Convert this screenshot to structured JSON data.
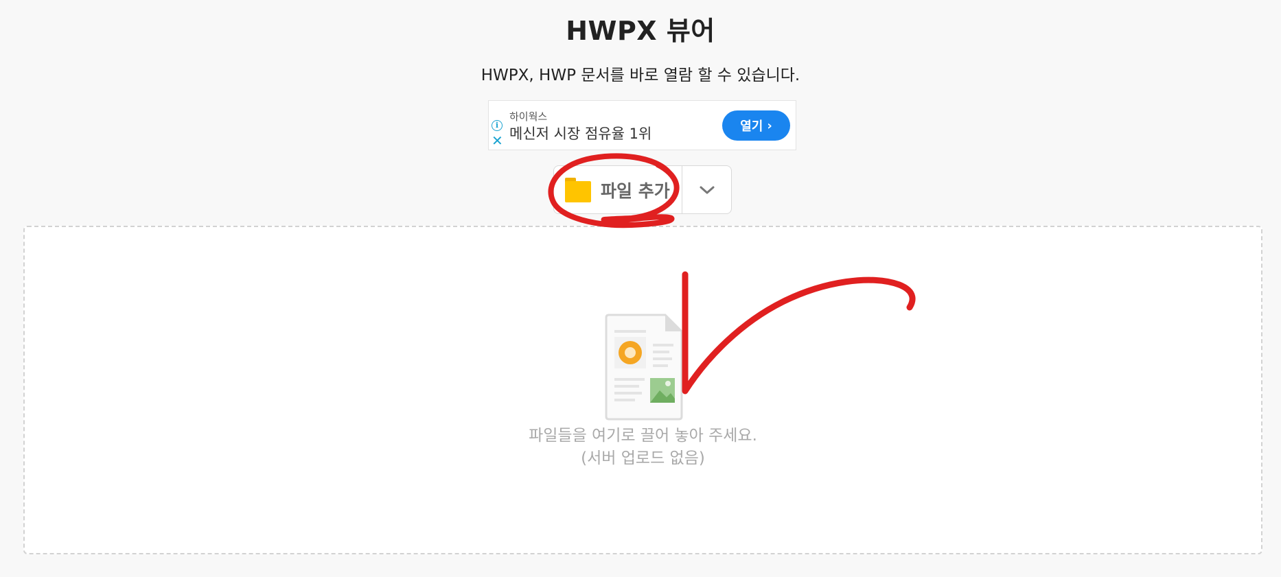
{
  "header": {
    "title": "HWPX 뷰어",
    "subtitle": "HWPX, HWP 문서를 바로 열람 할 수 있습니다."
  },
  "ad": {
    "info_glyph": "i",
    "close_glyph": "✕",
    "brand": "하이웍스",
    "text": "메신저 시장 점유율 1위",
    "button_label": "열기",
    "button_chevron": "›",
    "button_color": "#1a85ef"
  },
  "toolbar": {
    "add_file_label": "파일 추가",
    "folder_icon": "folder-icon",
    "dropdown_icon": "chevron-down-icon"
  },
  "dropzone": {
    "line1": "파일들을 여기로 끌어 놓아 주세요.",
    "line2": "(서버 업로드 없음)",
    "illustration_icon": "document-illustration-icon"
  },
  "colors": {
    "background": "#f8f8f8",
    "annotation": "#e02020",
    "folder": "#ffc400",
    "hint_text": "#a9a9a9"
  }
}
